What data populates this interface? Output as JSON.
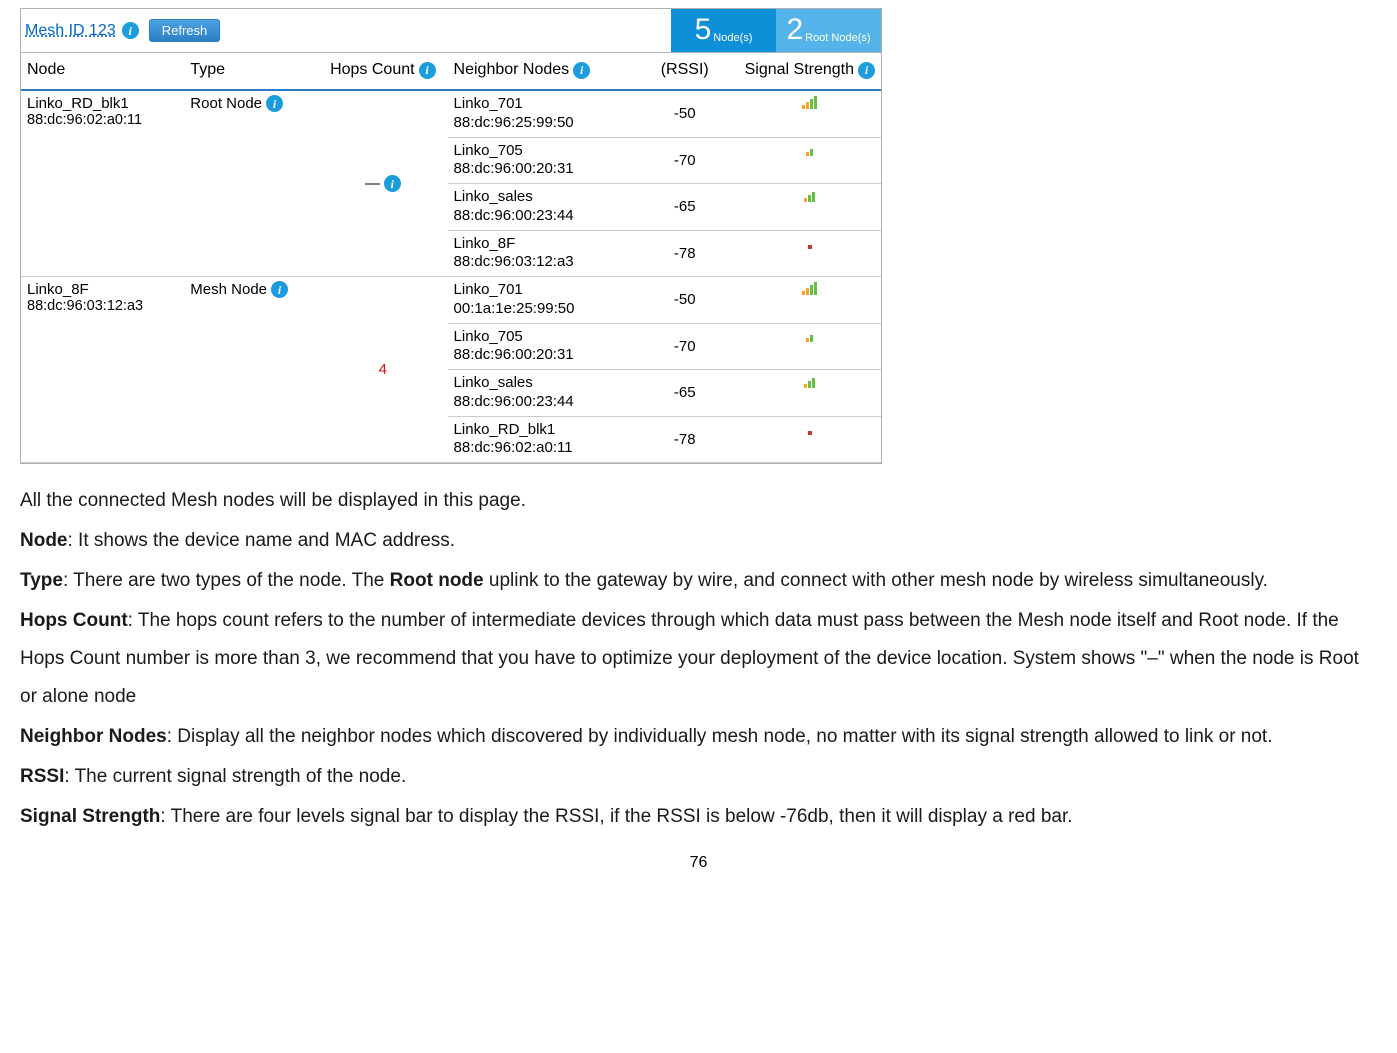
{
  "header": {
    "mesh_id_label": "Mesh ID 123",
    "refresh": "Refresh",
    "nodes_count": "5",
    "nodes_label": "Node(s)",
    "root_count": "2",
    "root_label": "Root Node(s)"
  },
  "columns": {
    "node": "Node",
    "type": "Type",
    "hops": "Hops Count",
    "neighbor": "Neighbor Nodes",
    "rssi": "(RSSI)",
    "signal": "Signal Strength"
  },
  "groups": [
    {
      "node_name": "Linko_RD_blk1",
      "node_mac": "88:dc:96:02:a0:11",
      "type": "Root Node",
      "hops": "—",
      "hops_style": "dash",
      "neighbors": [
        {
          "name": "Linko_701",
          "mac": "88:dc:96:25:99:50",
          "rssi": "-50",
          "bars": 4
        },
        {
          "name": "Linko_705",
          "mac": "88:dc:96:00:20:31",
          "rssi": "-70",
          "bars": 2
        },
        {
          "name": "Linko_sales",
          "mac": "88:dc:96:00:23:44",
          "rssi": "-65",
          "bars": 3
        },
        {
          "name": "Linko_8F",
          "mac": "88:dc:96:03:12:a3",
          "rssi": "-78",
          "bars": 1
        }
      ]
    },
    {
      "node_name": "Linko_8F",
      "node_mac": "88:dc:96:03:12:a3",
      "type": "Mesh Node",
      "hops": "4",
      "hops_style": "red",
      "neighbors": [
        {
          "name": "Linko_701",
          "mac": "00:1a:1e:25:99:50",
          "rssi": "-50",
          "bars": 4
        },
        {
          "name": "Linko_705",
          "mac": "88:dc:96:00:20:31",
          "rssi": "-70",
          "bars": 2
        },
        {
          "name": "Linko_sales",
          "mac": "88:dc:96:00:23:44",
          "rssi": "-65",
          "bars": 3
        },
        {
          "name": "Linko_RD_blk1",
          "mac": "88:dc:96:02:a0:11",
          "rssi": "-78",
          "bars": 1
        }
      ]
    }
  ],
  "doc": {
    "intro": "All the connected Mesh nodes will be displayed in this page.",
    "node_label": "Node",
    "node_text": ": It shows the device name and MAC address.",
    "type_label": "Type",
    "type_text_a": ": There are two types of the node. The ",
    "type_root": "Root node",
    "type_text_b": " uplink to the gateway by wire, and connect with other mesh node by wireless simultaneously.",
    "hops_label": "Hops Count",
    "hops_text": ": The hops count refers to the number of intermediate devices through which data must pass between the Mesh node itself and Root node. If the Hops Count number is more than 3, we recommend that you have to optimize your deployment of the device location. System shows \"–\" when the node is Root or alone node",
    "neighbor_label": "Neighbor Nodes",
    "neighbor_text": ": Display all the neighbor nodes which discovered by individually mesh node, no matter with its signal strength allowed to link or not.",
    "rssi_label": "RSSI",
    "rssi_text": ": The current signal strength of the node.",
    "signal_label": "Signal Strength",
    "signal_text": ": There are four levels signal bar to display the RSSI, if the RSSI is below -76db, then it will display a red bar."
  },
  "page_number": "76"
}
